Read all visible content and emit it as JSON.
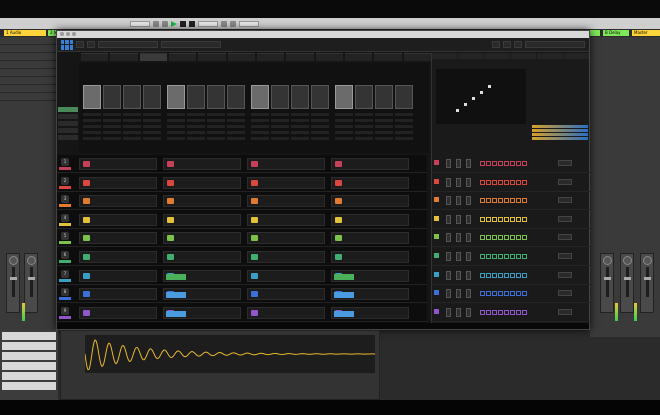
{
  "host": {
    "track_headers": [
      "1 Audio",
      "2 MIDI",
      "A Reverb",
      "B Delay",
      "Master"
    ],
    "header_colors": [
      "#ffd33a",
      "#7ee85a",
      "#7ee85a",
      "#7ee85a",
      "#ffd33a"
    ]
  },
  "plugin": {
    "tabs": [
      "",
      "",
      "",
      "",
      "",
      "",
      "",
      "",
      "",
      "",
      "",
      ""
    ],
    "active_tab": 2,
    "row_numbers": [
      "1",
      "2",
      "3",
      "4",
      "5",
      "6",
      "7",
      "8",
      "9"
    ],
    "row_colors": [
      "#c7405a",
      "#d9473e",
      "#e07b2f",
      "#e2c23a",
      "#7cc24a",
      "#3fae6f",
      "#3a9fc4",
      "#3d6fd8",
      "#9156c9"
    ],
    "side_labels": [
      "",
      "",
      "",
      "",
      ""
    ],
    "status_text": ""
  },
  "colors": {
    "accent_green": "#1fb64a",
    "accent_blue": "#4a9be0",
    "wave": "#e8b830"
  }
}
